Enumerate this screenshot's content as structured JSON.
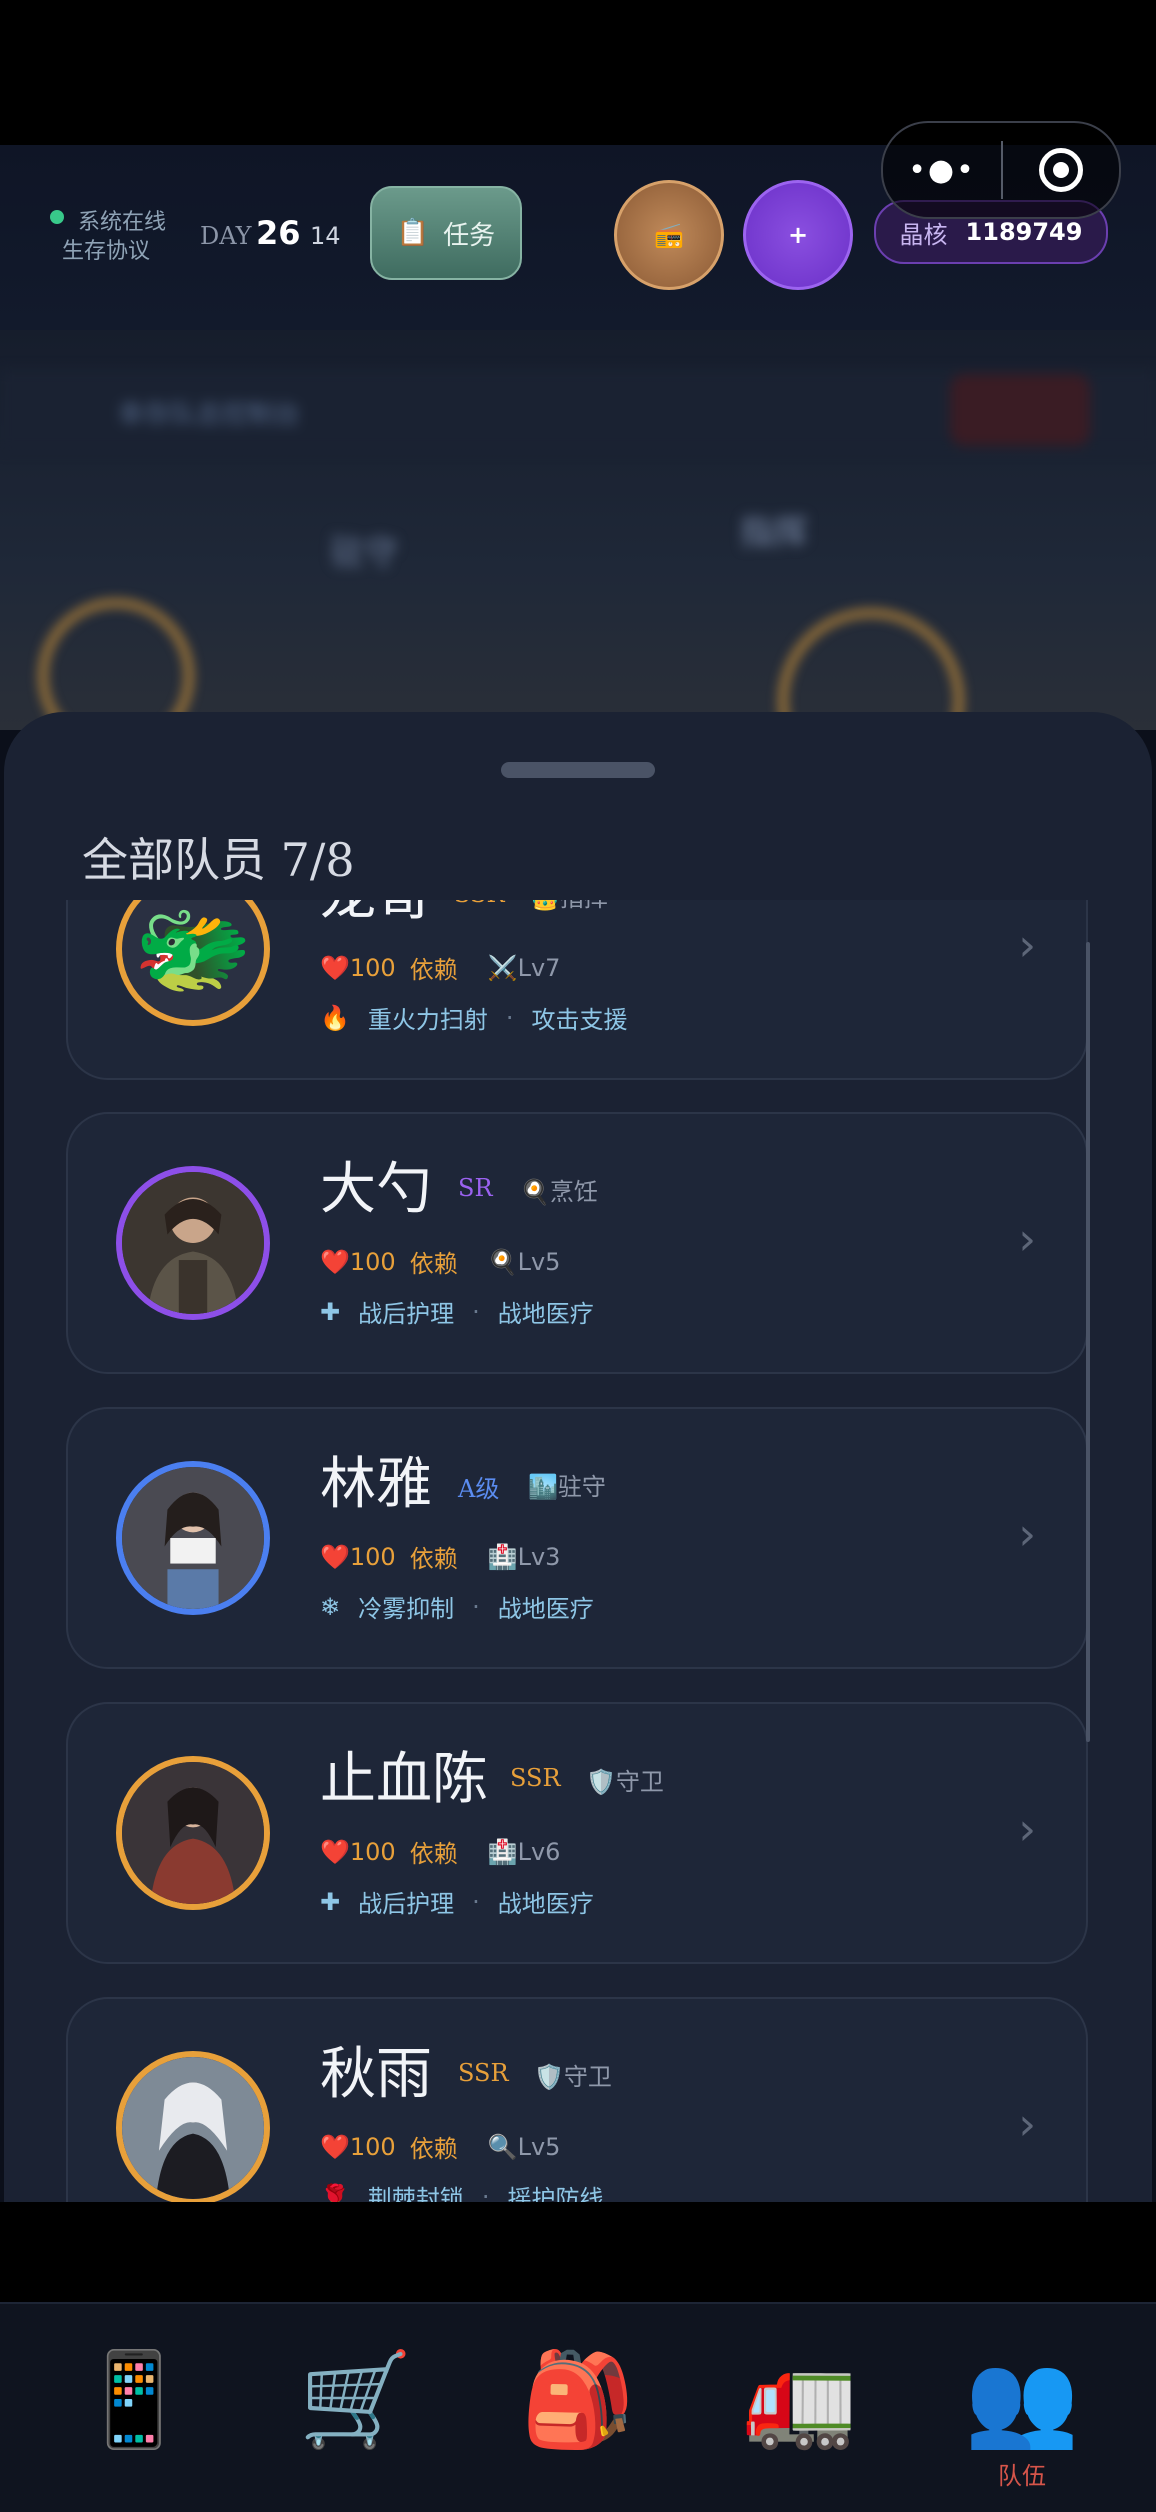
{
  "header": {
    "status_online": "系统在线",
    "status_protocol": "生存协议",
    "day_label": "DAY",
    "day_number": "26",
    "day_hour": "14",
    "task_label": "任务",
    "plus_label": "+",
    "crystal_label": "晶核",
    "crystal_value": "1189749",
    "capsule_more": "•●•"
  },
  "scene": {
    "control_text": "幸存队总控制台",
    "command_text": "指挥",
    "station_text": "驻守"
  },
  "sheet": {
    "title": "全部队员 7/8"
  },
  "members": [
    {
      "name": "龙哥",
      "rarity": "SSR",
      "role": "👑指挥",
      "hp": "❤️100",
      "dependency": "依赖",
      "level": "⚔️Lv7",
      "skill_icon": "🔥",
      "skill1": "重火力扫射",
      "skill2": "攻击支援"
    },
    {
      "name": "大勺",
      "rarity": "SR",
      "role": "🍳烹饪",
      "hp": "❤️100",
      "dependency": "依赖",
      "level": "🍳Lv5",
      "skill_icon": "✚",
      "skill1": "战后护理",
      "skill2": "战地医疗"
    },
    {
      "name": "林雅",
      "rarity": "A级",
      "role": "🏙️驻守",
      "hp": "❤️100",
      "dependency": "依赖",
      "level": "🏥Lv3",
      "skill_icon": "❄",
      "skill1": "冷雾抑制",
      "skill2": "战地医疗"
    },
    {
      "name": "止血陈",
      "rarity": "SSR",
      "role": "🛡️守卫",
      "hp": "❤️100",
      "dependency": "依赖",
      "level": "🏥Lv6",
      "skill_icon": "✚",
      "skill1": "战后护理",
      "skill2": "战地医疗"
    },
    {
      "name": "秋雨",
      "rarity": "SSR",
      "role": "🛡️守卫",
      "hp": "❤️100",
      "dependency": "依赖",
      "level": "🔍Lv5",
      "skill_icon": "🌹",
      "skill1": "荆棘封锁",
      "skill2": "摇护防线"
    }
  ],
  "separator": "·",
  "tabs": [
    {
      "icon": "📱",
      "label": ""
    },
    {
      "icon": "🛒",
      "label": ""
    },
    {
      "icon": "🎒",
      "label": ""
    },
    {
      "icon": "🚛",
      "label": ""
    },
    {
      "icon": "👥",
      "label": "队伍"
    }
  ],
  "icons": {
    "avatar_1": "🐲"
  },
  "colors": {
    "ssr": "#e8a03a",
    "sr": "#9b62f0",
    "a": "#5b8cf0",
    "accent_purple": "#6b30c8",
    "online_green": "#38c98a"
  }
}
